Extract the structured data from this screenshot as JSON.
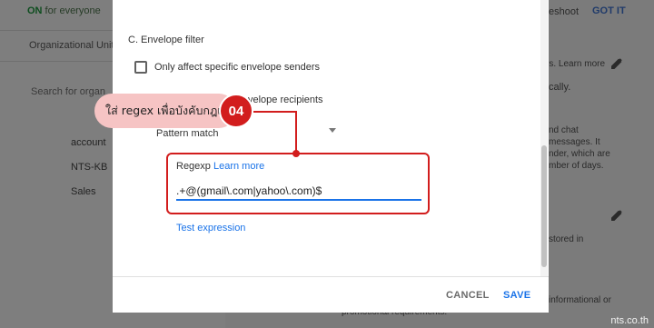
{
  "background": {
    "status_on": "ON",
    "status_rest": " for everyone",
    "org_units": "Organizational Units",
    "search_placeholder": "Search for organ",
    "org_items": [
      "account",
      "NTS-KB",
      "Sales"
    ],
    "right_texts": {
      "troubleshoot": "eshoot",
      "got_it": "GOT IT",
      "learn_more": "rs. Learn more",
      "cally": "cally.",
      "chat": "nd chat",
      "messages": "messages. It",
      "sender": "nder, which are",
      "days": "mber of days.",
      "stored": "stored in",
      "informational": "informational or",
      "promotional": "promotional requirements."
    }
  },
  "dialog": {
    "section_title": "C. Envelope filter",
    "checkbox_senders": "Only affect specific envelope senders",
    "recipients_partial": "velope recipients",
    "match_type": "Pattern match",
    "regexp_label": "Regexp",
    "learn_more": "Learn more",
    "regexp_value": ".+@(gmail\\.com|yahoo\\.com)$",
    "test_expression": "Test expression",
    "cancel_label": "CANCEL",
    "save_label": "SAVE"
  },
  "annotation": {
    "text": "ใส่ regex เพื่อบังคับกฎเฉพาะ",
    "step": "04",
    "color": "#d21d1d"
  },
  "watermark": "nts.co.th"
}
